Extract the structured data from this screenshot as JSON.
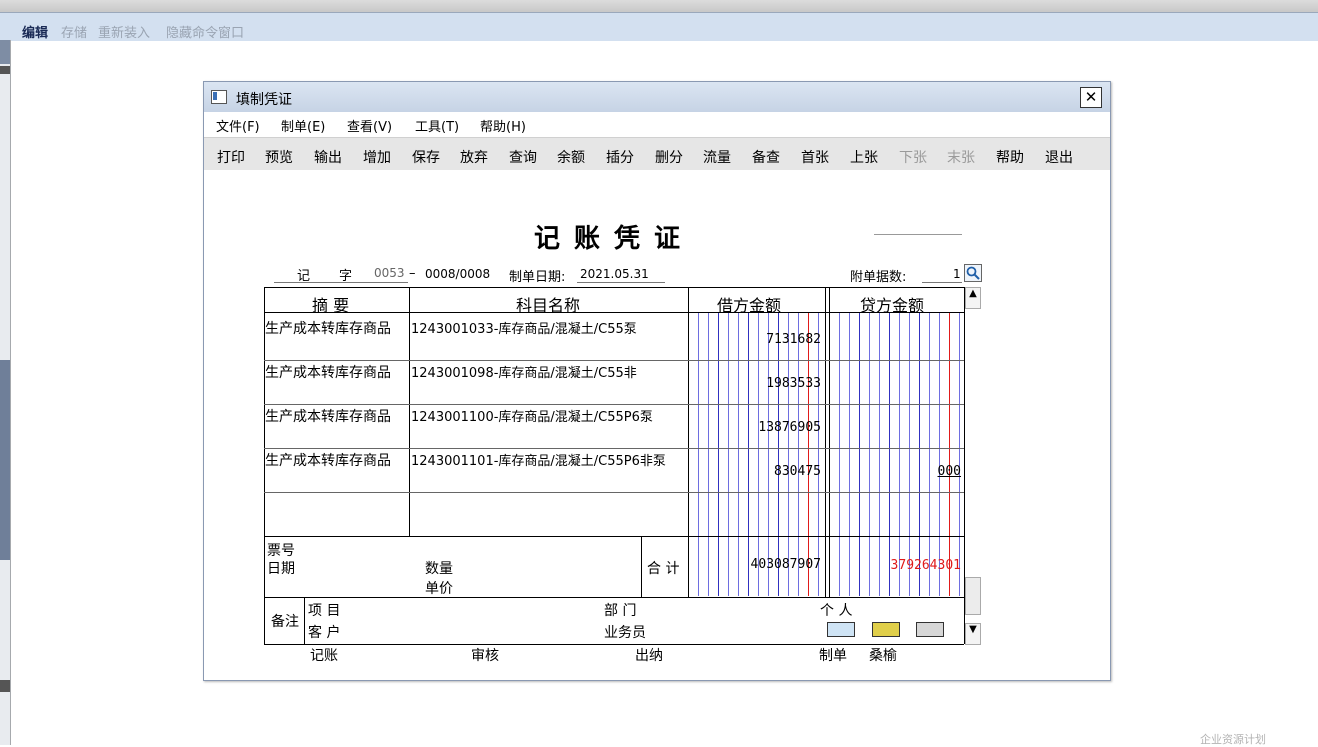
{
  "app_menu": {
    "items": [
      "编辑",
      "存储",
      "重新装入",
      "隐藏命令窗口"
    ]
  },
  "window": {
    "title": "填制凭证",
    "close": "✕",
    "menu": [
      "文件(F)",
      "制单(E)",
      "查看(V)",
      "工具(T)",
      "帮助(H)"
    ],
    "toolbar": [
      "打印",
      "预览",
      "输出",
      "增加",
      "保存",
      "放弃",
      "查询",
      "余额",
      "插分",
      "删分",
      "流量",
      "备查",
      "首张",
      "上张",
      "下张",
      "末张",
      "帮助",
      "退出"
    ]
  },
  "voucher": {
    "title": "记账凭证",
    "type_label": "记",
    "type_suffix": "字",
    "number": "0053",
    "dash": "–",
    "page": "0008/0008",
    "date_label": "制单日期:",
    "date": "2021.05.31",
    "attachments_label": "附单据数:",
    "attachments": "1",
    "columns": {
      "summary": "摘 要",
      "account": "科目名称",
      "debit": "借方金额",
      "credit": "贷方金额"
    },
    "rows": [
      {
        "summary": "生产成本转库存商品",
        "account": "1243001033-库存商品/混凝土/C55泵",
        "debit": "7131682",
        "credit": ""
      },
      {
        "summary": "生产成本转库存商品",
        "account": "1243001098-库存商品/混凝土/C55非",
        "debit": "1983533",
        "credit": ""
      },
      {
        "summary": "生产成本转库存商品",
        "account": "1243001100-库存商品/混凝土/C55P6泵",
        "debit": "13876905",
        "credit": ""
      },
      {
        "summary": "生产成本转库存商品",
        "account": "1243001101-库存商品/混凝土/C55P6非泵",
        "debit": "830475",
        "credit": "000"
      }
    ],
    "ticket_label": "票号",
    "date_row_label": "日期",
    "qty_label": "数量",
    "price_label": "单价",
    "total_label": "合 计",
    "debit_total": "403087907",
    "credit_total": "379264301",
    "remark_label": "备注",
    "project_label": "项  目",
    "customer_label": "客  户",
    "dept_label": "部  门",
    "salesman_label": "业务员",
    "person_label": "个  人",
    "bookkeeper_label": "记账",
    "auditor_label": "审核",
    "cashier_label": "出纳",
    "maker_label": "制单",
    "maker_name": "桑榆"
  },
  "watermark": "企业资源计划",
  "icons": {
    "magnifier": "magnifier-icon",
    "window": "window-icon"
  }
}
